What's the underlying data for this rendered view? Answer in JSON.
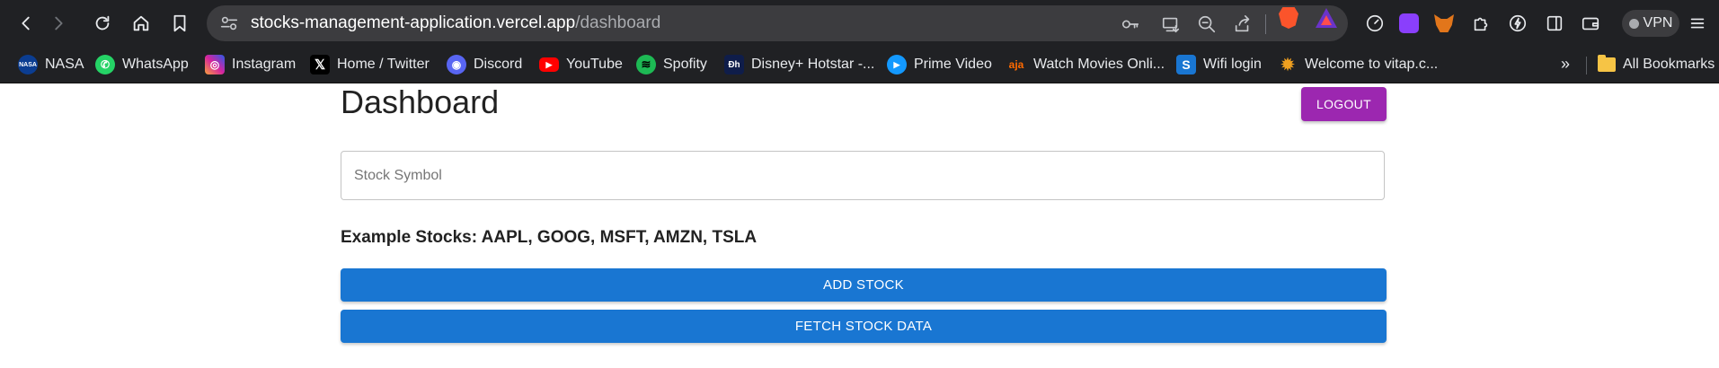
{
  "browser": {
    "url_host": "stocks-management-application.vercel.app",
    "url_path": "/dashboard",
    "vpn_label": "VPN"
  },
  "bookmarks": [
    {
      "label": "NASA",
      "icon": "nasa-icon",
      "color": "#0b3d91"
    },
    {
      "label": "WhatsApp",
      "icon": "whatsapp-icon",
      "color": "#25d366"
    },
    {
      "label": "Instagram",
      "icon": "instagram-icon",
      "color": "#d6249f"
    },
    {
      "label": "Home / Twitter",
      "icon": "x-icon",
      "color": "#000000"
    },
    {
      "label": "Discord",
      "icon": "discord-icon",
      "color": "#5865f2"
    },
    {
      "label": "YouTube",
      "icon": "youtube-icon",
      "color": "#ff0000"
    },
    {
      "label": "Spofity",
      "icon": "spotify-icon",
      "color": "#1db954"
    },
    {
      "label": "Disney+ Hotstar -...",
      "icon": "hotstar-icon",
      "color": "#0f1d4a"
    },
    {
      "label": "Prime Video",
      "icon": "prime-video-icon",
      "color": "#1399ff"
    },
    {
      "label": "Watch Movies Onli...",
      "icon": "movies-icon",
      "color": "#ff6a00"
    },
    {
      "label": "Wifi login",
      "icon": "wifi-login-icon",
      "color": "#1976d2"
    },
    {
      "label": "Welcome to vitap.c...",
      "icon": "vitap-icon",
      "color": "#f0a020"
    }
  ],
  "bookmarks_more": "»",
  "all_bookmarks_label": "All Bookmarks",
  "page": {
    "title": "Dashboard",
    "logout_label": "LOGOUT",
    "symbol_placeholder": "Stock Symbol",
    "symbol_value": "",
    "examples_text": "Example Stocks: AAPL, GOOG, MSFT, AMZN, TSLA",
    "add_stock_label": "ADD STOCK",
    "fetch_label": "FETCH STOCK DATA"
  },
  "colors": {
    "logout": "#9c27b0",
    "primary": "#1976d2",
    "chrome": "#202124"
  }
}
